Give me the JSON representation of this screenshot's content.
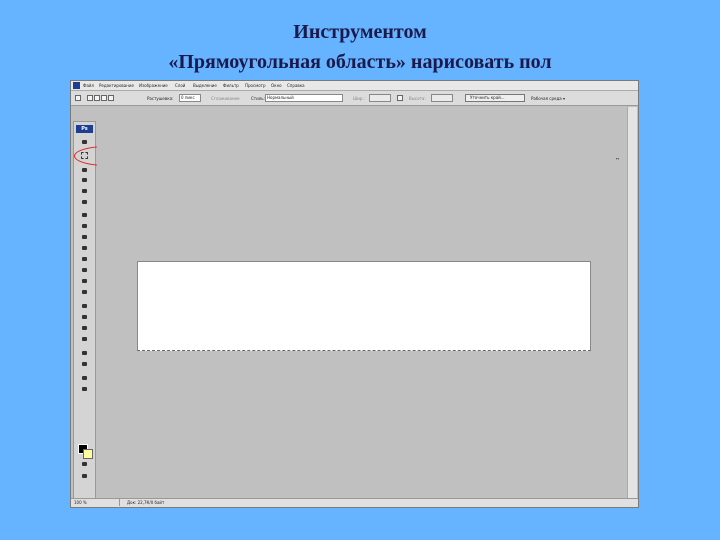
{
  "slide": {
    "title_line1": "Инструментом",
    "title_line2": "«Прямоугольная область» нарисовать пол"
  },
  "app": {
    "logo_text": "Ps",
    "menu": [
      "Файл",
      "Редактирование",
      "Изображение",
      "Слой",
      "Выделение",
      "Фильтр",
      "Просмотр",
      "Окно",
      "Справка"
    ],
    "options": {
      "feather_label": "Растушевка:",
      "feather_value": "0 пикс",
      "antialias_label": "Сглаживание",
      "style_label": "Стиль:",
      "style_value": "Нормальный",
      "width_label": "Шир.:",
      "height_label": "Высота:",
      "refine_button": "Уточнить край...",
      "workspace_label": "Рабочая среда ▾"
    },
    "status": {
      "zoom": "100 %",
      "doc_info": "Док: 22,7К/0 байт"
    },
    "corner_mark": "↔"
  }
}
